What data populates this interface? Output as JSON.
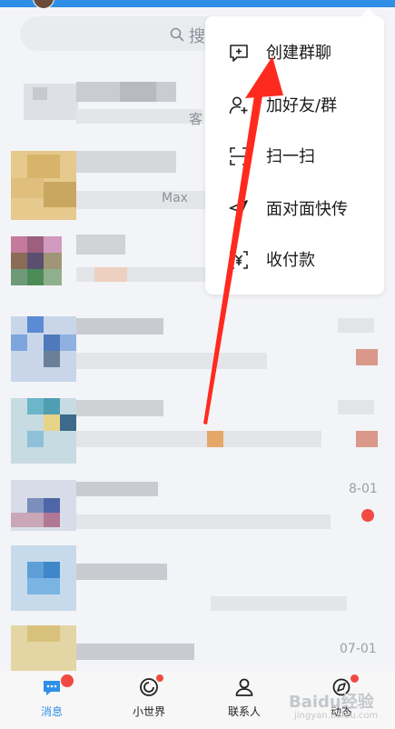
{
  "search": {
    "placeholder_visible": "搜"
  },
  "colors": {
    "accent": "#2f8fe6",
    "arrow": "#ff2a1f",
    "badge": "#f04a43"
  },
  "list_fragments": {
    "row1_fragment": "客",
    "row2_fragment": "Max"
  },
  "list_times": [
    "8-01",
    "07-01"
  ],
  "popup_menu": {
    "items": [
      {
        "label": "创建群聊",
        "icon": "add-chat-icon"
      },
      {
        "label": "加好友/群",
        "icon": "add-friend-icon"
      },
      {
        "label": "扫一扫",
        "icon": "scan-icon"
      },
      {
        "label": "面对面快传",
        "icon": "send-icon"
      },
      {
        "label": "收付款",
        "icon": "payment-icon"
      }
    ]
  },
  "tabbar": {
    "tabs": [
      {
        "label": "消息",
        "icon": "message-icon",
        "active": true
      },
      {
        "label": "小世界",
        "icon": "world-icon",
        "active": false
      },
      {
        "label": "联系人",
        "icon": "contacts-icon",
        "active": false
      },
      {
        "label": "动态",
        "icon": "activity-icon",
        "active": false
      }
    ]
  },
  "watermark": {
    "logo": "Baidu经验",
    "url": "jingyan.baidu.com"
  }
}
